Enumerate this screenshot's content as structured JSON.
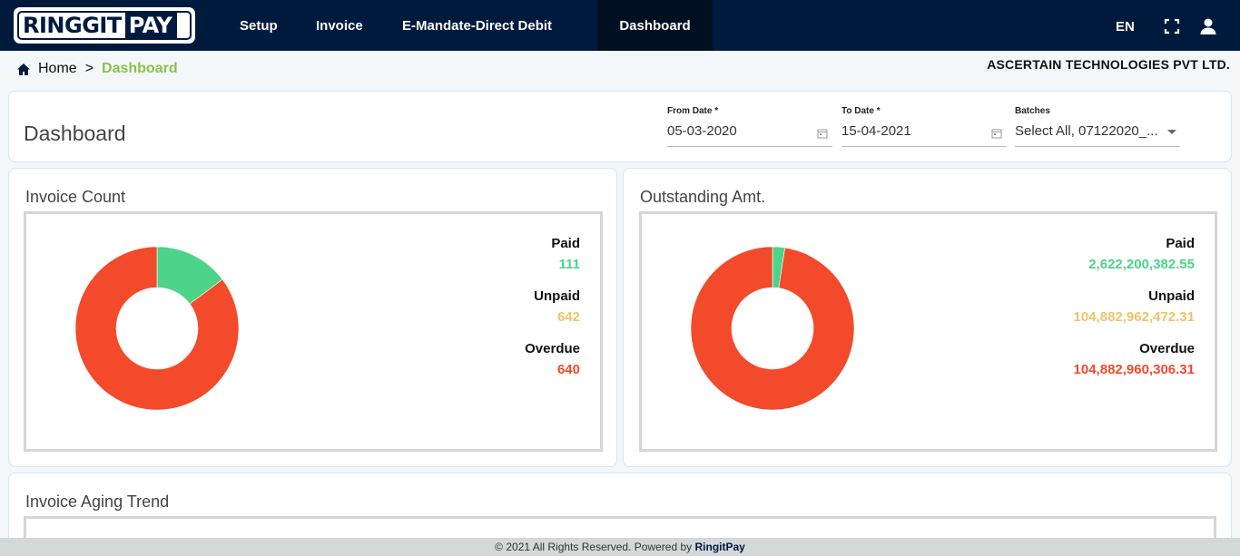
{
  "brand": {
    "logo_part1": "RINGGIT",
    "logo_part2": "PAY"
  },
  "nav": {
    "items": [
      "Setup",
      "Invoice",
      "E-Mandate-Direct Debit",
      "Dashboard"
    ],
    "active": "Dashboard",
    "language": "EN"
  },
  "breadcrumb": {
    "home": "Home",
    "separator": ">",
    "current": "Dashboard"
  },
  "company": "ASCERTAIN TECHNOLOGIES PVT LTD.",
  "header": {
    "title": "Dashboard",
    "from_date": {
      "label": "From Date *",
      "value": "05-03-2020"
    },
    "to_date": {
      "label": "To Date *",
      "value": "15-04-2021"
    },
    "batches": {
      "label": "Batches",
      "value": "Select All, 07122020_..."
    }
  },
  "invoice_count": {
    "title": "Invoice Count",
    "paid": {
      "label": "Paid",
      "value": "111"
    },
    "unpaid": {
      "label": "Unpaid",
      "value": "642"
    },
    "overdue": {
      "label": "Overdue",
      "value": "640"
    }
  },
  "outstanding": {
    "title": "Outstanding Amt.",
    "paid": {
      "label": "Paid",
      "value": "2,622,200,382.55"
    },
    "unpaid": {
      "label": "Unpaid",
      "value": "104,882,962,472.31"
    },
    "overdue": {
      "label": "Overdue",
      "value": "104,882,960,306.31"
    }
  },
  "aging": {
    "title": "Invoice Aging Trend"
  },
  "footer": {
    "text": "© 2021 All Rights Reserved. Powered by",
    "brand": "RingitPay"
  },
  "colors": {
    "paid": "#4cd48a",
    "unpaid": "#f2c26b",
    "overdue": "#f24a2a",
    "navy": "#001a3e",
    "breadcrumb_active": "#8bc34a"
  },
  "chart_data": [
    {
      "type": "pie",
      "title": "Invoice Count",
      "categories": [
        "Paid",
        "Unpaid",
        "Overdue"
      ],
      "values": [
        111,
        642,
        640
      ],
      "donut": true,
      "visible_slices": {
        "Paid": 111,
        "Overdue": 640
      }
    },
    {
      "type": "pie",
      "title": "Outstanding Amt.",
      "categories": [
        "Paid",
        "Unpaid",
        "Overdue"
      ],
      "values": [
        2622200382.55,
        104882962472.31,
        104882960306.31
      ],
      "donut": true,
      "visible_slices": {
        "Paid": 2622200382.55,
        "Overdue": 104882960306.31
      }
    }
  ]
}
